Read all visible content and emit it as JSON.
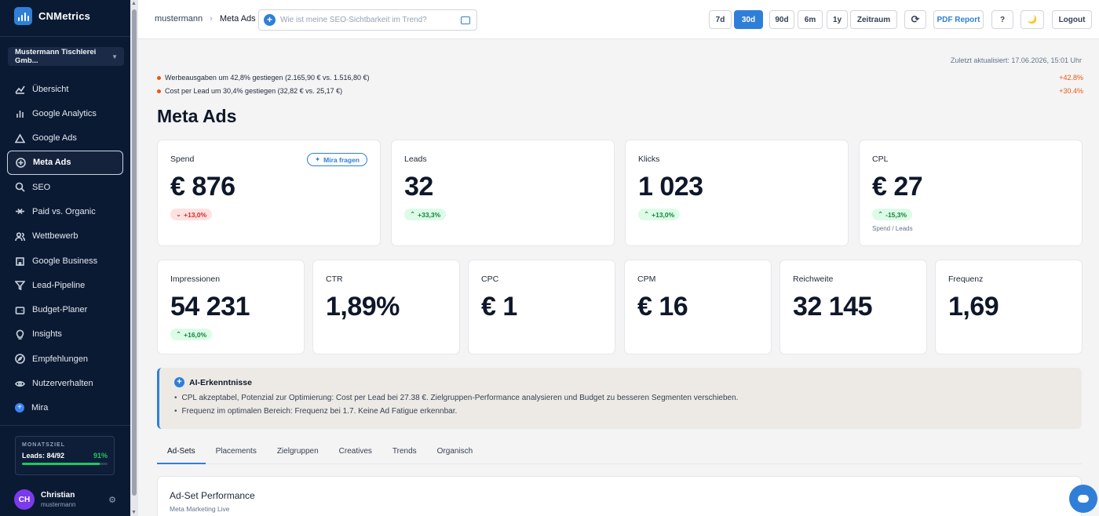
{
  "brand": {
    "name": "CNMetrics"
  },
  "org": {
    "selected": "Mustermann Tischlerei Gmb..."
  },
  "nav": [
    {
      "label": "Übersicht",
      "icon": "trend-icon"
    },
    {
      "label": "Google Analytics",
      "icon": "bar-chart-icon"
    },
    {
      "label": "Google Ads",
      "icon": "triangle-icon"
    },
    {
      "label": "Meta Ads",
      "icon": "plus-circle-icon",
      "active": true
    },
    {
      "label": "SEO",
      "icon": "search-icon"
    },
    {
      "label": "Paid vs. Organic",
      "icon": "compare-icon"
    },
    {
      "label": "Wettbewerb",
      "icon": "users-icon"
    },
    {
      "label": "Google Business",
      "icon": "building-icon"
    },
    {
      "label": "Lead-Pipeline",
      "icon": "funnel-icon"
    },
    {
      "label": "Budget-Planer",
      "icon": "wallet-icon"
    },
    {
      "label": "Insights",
      "icon": "lightbulb-icon"
    },
    {
      "label": "Empfehlungen",
      "icon": "compass-icon"
    },
    {
      "label": "Nutzerverhalten",
      "icon": "eye-icon"
    },
    {
      "label": "Mira",
      "icon": "mira-icon"
    }
  ],
  "goal": {
    "title": "MONATSZIEL",
    "text": "Leads: 84/92",
    "pct": "91%",
    "fill": 0.91
  },
  "user": {
    "initials": "CH",
    "name": "Christian",
    "handle": "mustermann"
  },
  "breadcrumb": {
    "root": "mustermann",
    "sep": "›",
    "current": "Meta Ads"
  },
  "search": {
    "placeholder": "Wie ist meine SEO-Sichtbarkeit im Trend?"
  },
  "ranges": [
    "7d",
    "30d",
    "90d",
    "6m",
    "1y",
    "Zeitraum"
  ],
  "toolbar": {
    "refresh": "⟳",
    "pdf": "PDF Report",
    "help": "?",
    "theme": "🌙",
    "logout": "Logout"
  },
  "updated": "Zuletzt aktualisiert: 17.06.2026, 15:01 Uhr",
  "alerts": [
    {
      "text": "Werbeausgaben um 42,8% gestiegen (2.165,90 € vs. 1.516,80 €)",
      "change": "+42.8%"
    },
    {
      "text": "Cost per Lead um 30,4% gestiegen (32,82 € vs. 25,17 €)",
      "change": "+30.4%"
    }
  ],
  "page_title": "Meta Ads",
  "kpis_top": [
    {
      "label": "Spend",
      "value": "€ 876",
      "badge": "+13,0%",
      "dir": "down",
      "arrow": "⌄",
      "mira": "Mira fragen"
    },
    {
      "label": "Leads",
      "value": "32",
      "badge": "+33,3%",
      "dir": "up",
      "arrow": "⌃"
    },
    {
      "label": "Klicks",
      "value": "1 023",
      "badge": "+13,0%",
      "dir": "up",
      "arrow": "⌃"
    },
    {
      "label": "CPL",
      "value": "€ 27",
      "badge": "-15,3%",
      "dir": "up",
      "arrow": "⌃",
      "sub": "Spend / Leads"
    }
  ],
  "kpis_bottom": [
    {
      "label": "Impressionen",
      "value": "54 231",
      "badge": "+16,0%",
      "dir": "up",
      "arrow": "⌃"
    },
    {
      "label": "CTR",
      "value": "1,89%"
    },
    {
      "label": "CPC",
      "value": "€ 1"
    },
    {
      "label": "CPM",
      "value": "€ 16"
    },
    {
      "label": "Reichweite",
      "value": "32 145"
    },
    {
      "label": "Frequenz",
      "value": "1,69"
    }
  ],
  "ai": {
    "title": "AI-Erkenntnisse",
    "items": [
      "CPL akzeptabel, Potenzial zur Optimierung: Cost per Lead bei 27.38 €. Zielgruppen-Performance analysieren und Budget zu besseren Segmenten verschieben.",
      "Frequenz im optimalen Bereich: Frequenz bei 1.7. Keine Ad Fatigue erkennbar."
    ]
  },
  "tabs": [
    "Ad-Sets",
    "Placements",
    "Zielgruppen",
    "Creatives",
    "Trends",
    "Organisch"
  ],
  "perf": {
    "title": "Ad-Set Performance",
    "subtitle": "Meta Marketing Live"
  }
}
